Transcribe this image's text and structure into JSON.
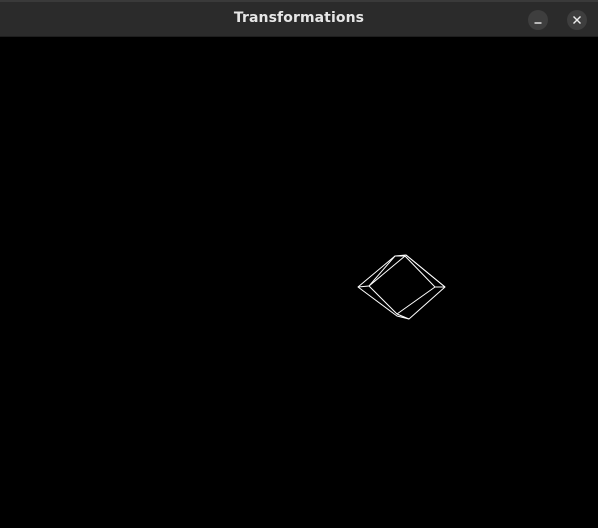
{
  "window": {
    "title": "Transformations",
    "buttons": {
      "minimize": "minimize-icon",
      "close": "close-icon"
    }
  },
  "canvas": {
    "background": "#000000",
    "stroke": "#ffffff",
    "shape": "wireframe-cube"
  }
}
